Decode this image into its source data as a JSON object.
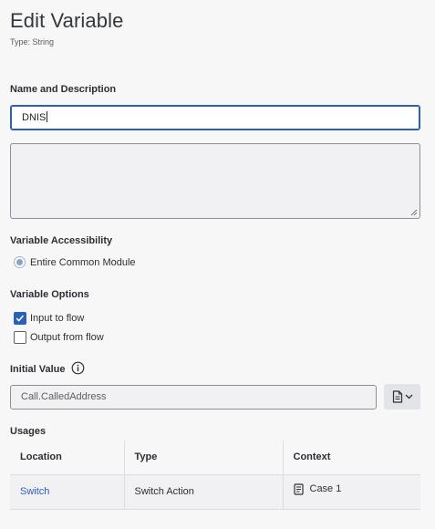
{
  "header": {
    "title": "Edit Variable",
    "subtitle": "Type: String"
  },
  "name_section": {
    "label": "Name and Description",
    "name_value": "DNIS",
    "description_value": ""
  },
  "accessibility": {
    "label": "Variable Accessibility",
    "option_label": "Entire Common Module",
    "selected": true
  },
  "options": {
    "label": "Variable Options",
    "input_to_flow": {
      "label": "Input to flow",
      "checked": true
    },
    "output_from_flow": {
      "label": "Output from flow",
      "checked": false
    }
  },
  "initial_value": {
    "label": "Initial Value",
    "value": "Call.CalledAddress",
    "info_icon": "info-circle-icon",
    "expression_button_icon": "document-icon"
  },
  "usages": {
    "label": "Usages",
    "columns": [
      "Location",
      "Type",
      "Context"
    ],
    "rows": [
      {
        "location": "Switch",
        "type": "Switch Action",
        "context": "Case 1",
        "context_icon": "book-icon"
      }
    ]
  },
  "colors": {
    "accent": "#2a60b8",
    "background": "#f7f7f8",
    "field_background": "#f1f1f3"
  }
}
